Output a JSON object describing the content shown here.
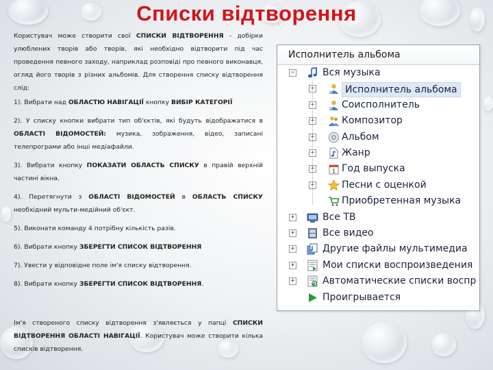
{
  "title": "Списки відтворення",
  "paragraphs": {
    "intro": [
      "Користувач може створити свої ",
      "СПИСКИ ВІДТВОРЕННЯ",
      " - добірки улюблених творів або творів, які необхідно відтворити під час проведення певного заходу, наприклад розповіді про певного виконавця, огляд його творів з різних альбомів. Для створення списку відтворення слід:"
    ],
    "s1": [
      "1). Вибрати над ",
      "ОБЛАСТЮ НАВІГАЦІЇ",
      " кнопку ",
      "ВИБІР КАТЕГОРІЇ"
    ],
    "s2": [
      "2). У списку кнопки вибрати тип об'єктів, які будуть відображатися в ",
      "ОБЛАСТІ ВІДОМОСТЕЙ:",
      " музика, зображення, відео, записані телепрограми або інші медіафайли."
    ],
    "s3": [
      "3). Вибрати кнопку ",
      "ПОКАЗАТИ ОБЛАСТЬ СПИСКУ",
      " в правій верхній частині вікна."
    ],
    "s4": [
      "4). Перетягнути з ",
      "ОБЛАСТІ ВІДОМОСТЕЙ",
      " в ",
      "ОБЛАСТЬ СПИСКУ",
      " необхідний мульти-медійний об'єкт."
    ],
    "s5": "5). Виконати команду 4 потрібну кількість разів.",
    "s6": [
      "6). Вибрати кнопку ",
      "ЗБЕРЕГТИ СПИСОК ВІДТВОРЕННЯ"
    ],
    "s7": "7). Увести у відповідне поле ім'я списку відтворення.",
    "s8": [
      "8). Вибрати кнопку ",
      "ЗБЕРЕГТИ СПИСОК ВІДТВОРЕННЯ",
      "."
    ],
    "outro": [
      "Ім'я створеного списку відтворення з'являється у папці ",
      "СПИСКИ ВІДТВОРЕННЯ ОБЛАСТІ НАВІГАЦІЇ",
      ". Користувач може створити кілька списків відтворення."
    ]
  },
  "tree": {
    "header": "Исполнитель альбома",
    "items": [
      {
        "label": "Вся музыка",
        "icon": "music-note-icon",
        "expander": "−"
      },
      {
        "label": "Исполнитель альбома",
        "icon": "person-icon",
        "expander": "+"
      },
      {
        "label": "Соисполнитель",
        "icon": "person-icon",
        "expander": "+"
      },
      {
        "label": "Композитор",
        "icon": "people-icon",
        "expander": "+"
      },
      {
        "label": "Альбом",
        "icon": "disc-icon",
        "expander": "+"
      },
      {
        "label": "Жанр",
        "icon": "genre-icon",
        "expander": "+"
      },
      {
        "label": "Год выпуска",
        "icon": "calendar-icon",
        "expander": "+"
      },
      {
        "label": "Песни с оценкой",
        "icon": "star-icon",
        "expander": "+"
      },
      {
        "label": "Приобретенная музыка",
        "icon": "cart-icon",
        "expander": ""
      },
      {
        "label": "Все ТВ",
        "icon": "tv-icon",
        "expander": "+"
      },
      {
        "label": "Все видео",
        "icon": "video-icon",
        "expander": "+"
      },
      {
        "label": "Другие файлы мультимедиа",
        "icon": "media-files-icon",
        "expander": "+"
      },
      {
        "label": "Мои списки воспроизведения",
        "icon": "playlist-icon",
        "expander": "+"
      },
      {
        "label": "Автоматические списки воспр",
        "icon": "auto-playlist-icon",
        "expander": "+"
      },
      {
        "label": "Проигрывается",
        "icon": "play-icon",
        "expander": ""
      }
    ]
  },
  "colors": {
    "title": "#d2141b",
    "selection": "#dfe9f5"
  }
}
